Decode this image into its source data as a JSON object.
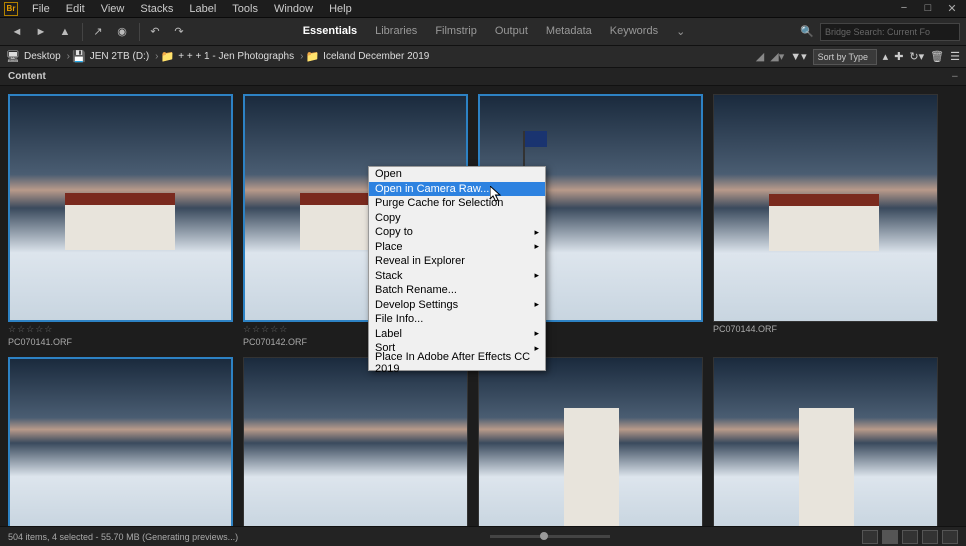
{
  "app": {
    "logo": "Br"
  },
  "menubar": [
    "File",
    "Edit",
    "View",
    "Stacks",
    "Label",
    "Tools",
    "Window",
    "Help"
  ],
  "workspaces": [
    {
      "label": "Essentials",
      "active": true
    },
    {
      "label": "Libraries",
      "active": false
    },
    {
      "label": "Filmstrip",
      "active": false
    },
    {
      "label": "Output",
      "active": false
    },
    {
      "label": "Metadata",
      "active": false
    },
    {
      "label": "Keywords",
      "active": false
    }
  ],
  "search": {
    "placeholder": "Bridge Search: Current Fo"
  },
  "breadcrumbs": [
    {
      "label": "Desktop"
    },
    {
      "label": "JEN 2TB (D:)"
    },
    {
      "label": "+ + + 1 - Jen Photographs"
    },
    {
      "label": "Iceland December 2019"
    }
  ],
  "sort": {
    "label": "Sort by Type"
  },
  "panel": {
    "title": "Content"
  },
  "thumbs": [
    {
      "file": "PC070141.ORF",
      "stars": "☆☆☆☆☆",
      "kind": "house",
      "selected": true
    },
    {
      "file": "PC070142.ORF",
      "stars": "☆☆☆☆☆",
      "kind": "house",
      "selected": true
    },
    {
      "file": "",
      "stars": "",
      "kind": "flag",
      "selected": true
    },
    {
      "file": "PC070144.ORF",
      "stars": "",
      "kind": "house",
      "selected": false
    },
    {
      "file": "",
      "stars": "",
      "kind": "plain",
      "selected": true,
      "short": true
    },
    {
      "file": "",
      "stars": "",
      "kind": "plain",
      "selected": false,
      "short": true
    },
    {
      "file": "",
      "stars": "",
      "kind": "tower",
      "selected": false,
      "short": true
    },
    {
      "file": "",
      "stars": "",
      "kind": "tower",
      "selected": false,
      "short": true
    }
  ],
  "context_menu": [
    {
      "label": "Open",
      "sub": false
    },
    {
      "label": "Open in Camera Raw...",
      "sub": false,
      "hover": true
    },
    {
      "label": "Purge Cache for Selection",
      "sub": false
    },
    {
      "label": "Copy",
      "sub": false
    },
    {
      "label": "Copy to",
      "sub": true
    },
    {
      "label": "Place",
      "sub": true
    },
    {
      "label": "Reveal in Explorer",
      "sub": false
    },
    {
      "label": "Stack",
      "sub": true
    },
    {
      "label": "Batch Rename...",
      "sub": false
    },
    {
      "label": "Develop Settings",
      "sub": true
    },
    {
      "label": "File Info...",
      "sub": false
    },
    {
      "label": "Label",
      "sub": true
    },
    {
      "label": "Sort",
      "sub": true
    },
    {
      "label": "Place In Adobe After Effects CC 2019",
      "sub": false
    }
  ],
  "status": "504 items, 4 selected - 55.70 MB (Generating previews...)"
}
